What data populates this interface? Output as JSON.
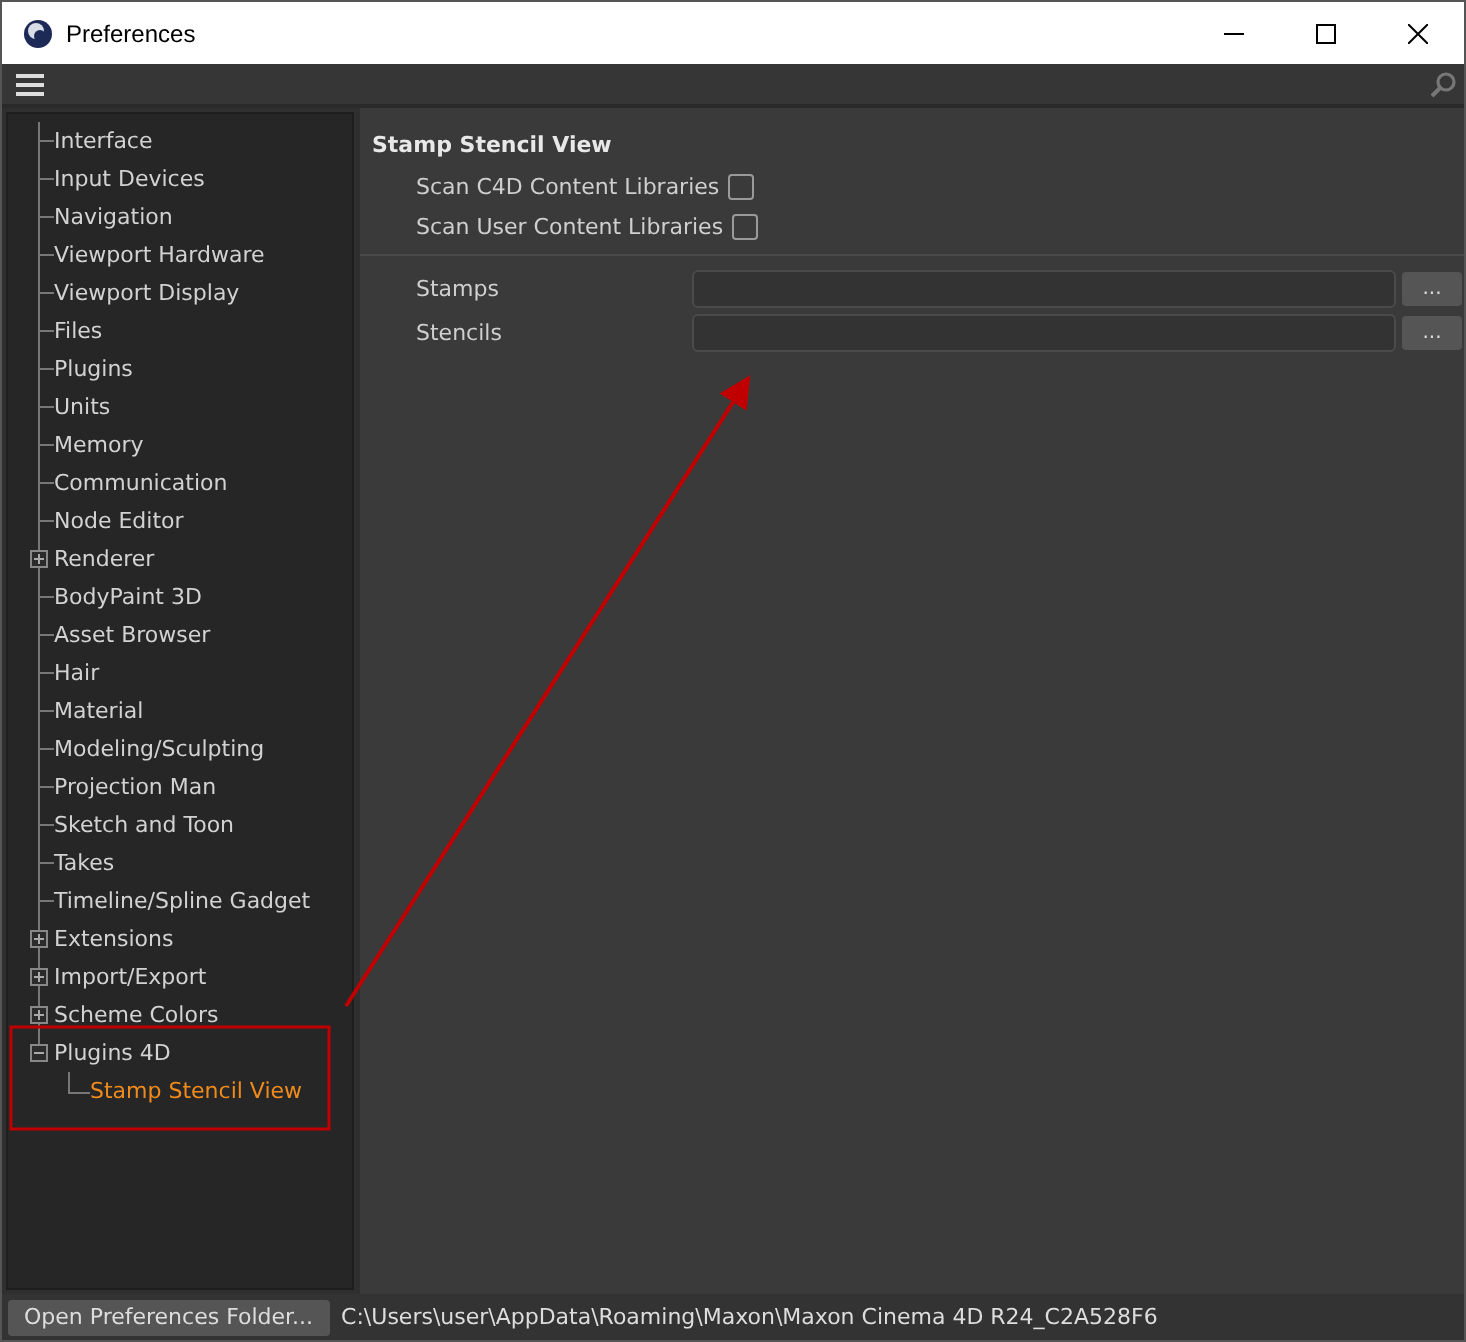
{
  "window": {
    "title": "Preferences"
  },
  "sidebar": {
    "items": [
      {
        "label": "Interface",
        "selected": false
      },
      {
        "label": "Input Devices",
        "selected": false
      },
      {
        "label": "Navigation",
        "selected": false
      },
      {
        "label": "Viewport Hardware",
        "selected": false
      },
      {
        "label": "Viewport Display",
        "selected": false
      },
      {
        "label": "Files",
        "selected": false
      },
      {
        "label": "Plugins",
        "selected": false
      },
      {
        "label": "Units",
        "selected": false
      },
      {
        "label": "Memory",
        "selected": false
      },
      {
        "label": "Communication",
        "selected": false
      },
      {
        "label": "Node Editor",
        "selected": false
      },
      {
        "label": "Renderer",
        "selected": false,
        "expanded": false
      },
      {
        "label": "BodyPaint 3D",
        "selected": false
      },
      {
        "label": "Asset Browser",
        "selected": false
      },
      {
        "label": "Hair",
        "selected": false
      },
      {
        "label": "Material",
        "selected": false
      },
      {
        "label": "Modeling/Sculpting",
        "selected": false
      },
      {
        "label": "Projection Man",
        "selected": false
      },
      {
        "label": "Sketch and Toon",
        "selected": false
      },
      {
        "label": "Takes",
        "selected": false
      },
      {
        "label": "Timeline/Spline Gadget",
        "selected": false
      },
      {
        "label": "Extensions",
        "selected": false,
        "expanded": false
      },
      {
        "label": "Import/Export",
        "selected": false,
        "expanded": false
      },
      {
        "label": "Scheme Colors",
        "selected": false,
        "expanded": false
      },
      {
        "label": "Plugins 4D",
        "selected": false,
        "expanded": true,
        "children": [
          {
            "label": "Stamp Stencil View",
            "selected": true
          }
        ]
      }
    ]
  },
  "panel": {
    "title": "Stamp Stencil View",
    "checkboxes": [
      {
        "label": "Scan C4D Content Libraries",
        "checked": false
      },
      {
        "label": "Scan User Content Libraries",
        "checked": false
      }
    ],
    "paths": [
      {
        "label": "Stamps",
        "button": "..."
      },
      {
        "label": "Stencils",
        "button": "..."
      }
    ]
  },
  "status_bar": {
    "button": "Open Preferences Folder...",
    "path": "C:\\Users\\user\\AppData\\Roaming\\Maxon\\Maxon Cinema 4D R24_C2A528F6"
  }
}
